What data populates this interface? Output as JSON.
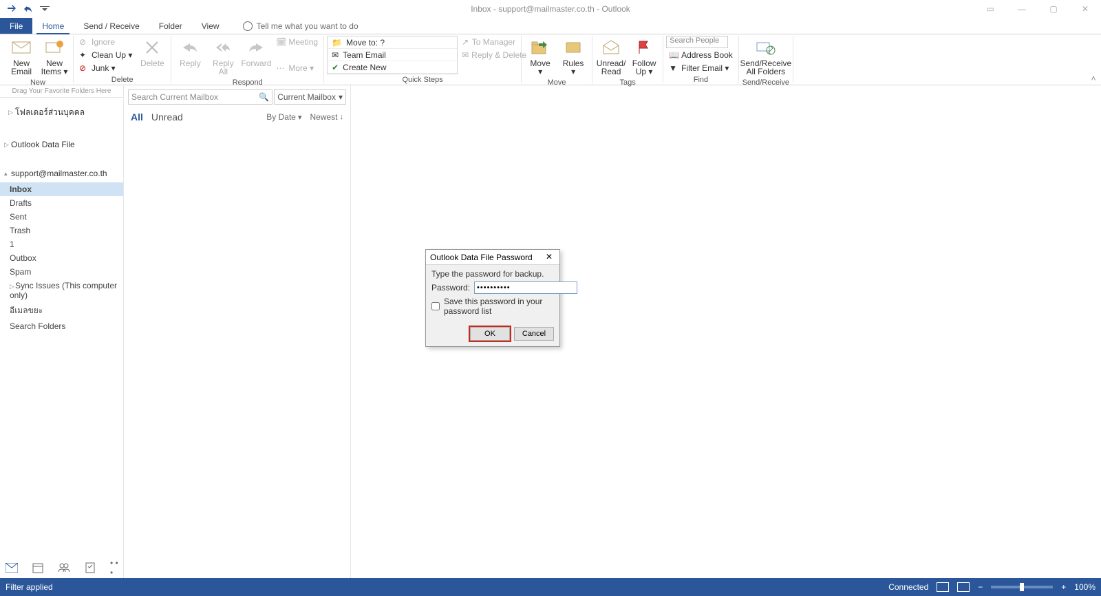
{
  "title": "Inbox - support@mailmaster.co.th - Outlook",
  "tabs": {
    "file": "File",
    "home": "Home",
    "sendreceive": "Send / Receive",
    "folder": "Folder",
    "view": "View",
    "tellme": "Tell me what you want to do"
  },
  "ribbon": {
    "new": {
      "new_email": "New\nEmail",
      "new_items": "New\nItems ▾",
      "label": "New"
    },
    "delete": {
      "ignore": "Ignore",
      "cleanup": "Clean Up ▾",
      "junk": "Junk ▾",
      "delete": "Delete",
      "label": "Delete"
    },
    "respond": {
      "reply": "Reply",
      "reply_all": "Reply\nAll",
      "forward": "Forward",
      "meeting": "Meeting",
      "more": "More ▾",
      "label": "Respond"
    },
    "quicksteps": {
      "moveto": "Move to: ?",
      "team": "Team Email",
      "createnew": "Create New",
      "tomgr": "To Manager",
      "replyd": "Reply & Delete",
      "label": "Quick Steps"
    },
    "move": {
      "move": "Move\n▾",
      "rules": "Rules\n▾",
      "label": "Move"
    },
    "tags": {
      "unread": "Unread/\nRead",
      "follow": "Follow\nUp ▾",
      "label": "Tags"
    },
    "find": {
      "search_people": "Search People",
      "address": "Address Book",
      "filter": "Filter Email ▾",
      "label": "Find"
    },
    "sr": {
      "sendrecv": "Send/Receive\nAll Folders",
      "label": "Send/Receive"
    }
  },
  "folder_pane": {
    "favorites_hint": "Drag Your Favorite Folders Here",
    "header1": "โฟลเดอร์ส่วนบุคคล",
    "header2": "Outlook Data File",
    "account": "support@mailmaster.co.th",
    "folders": [
      "Inbox",
      "Drafts",
      "Sent",
      "Trash",
      "1",
      "Outbox",
      "Spam",
      "Sync Issues (This computer only)",
      "อีเมลขยะ",
      "Search Folders"
    ]
  },
  "list": {
    "search_placeholder": "Search Current Mailbox",
    "scope": "Current Mailbox",
    "all": "All",
    "unread": "Unread",
    "bydate": "By Date",
    "newest": "Newest"
  },
  "dialog": {
    "title": "Outlook Data File Password",
    "prompt": "Type the password for backup.",
    "password_label": "Password:",
    "password_value": "••••••••••",
    "save_check": "Save this password in your password list",
    "ok": "OK",
    "cancel": "Cancel"
  },
  "status": {
    "filter_applied": "Filter applied",
    "connected": "Connected",
    "zoom": "100%"
  }
}
